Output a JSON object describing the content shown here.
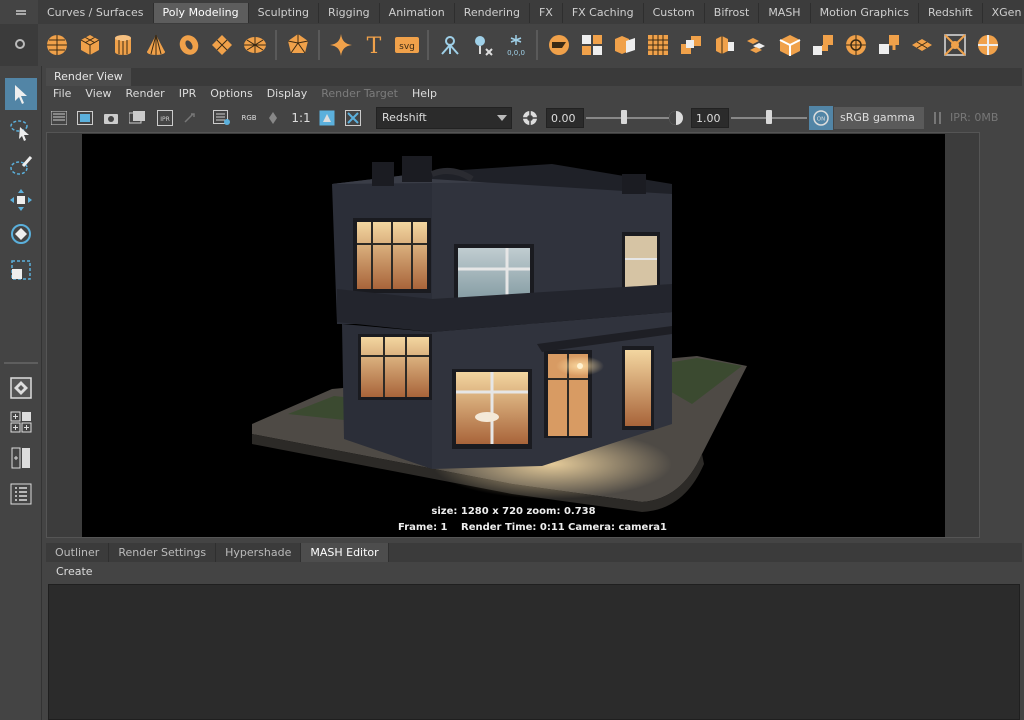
{
  "shelf": {
    "tabs": [
      "Curves / Surfaces",
      "Poly Modeling",
      "Sculpting",
      "Rigging",
      "Animation",
      "Rendering",
      "FX",
      "FX Caching",
      "Custom",
      "Bifrost",
      "MASH",
      "Motion Graphics",
      "Redshift",
      "XGen"
    ],
    "active_tab": "Poly Modeling",
    "icons": [
      "poly-sphere",
      "poly-cube",
      "poly-cylinder",
      "poly-cone",
      "poly-torus",
      "poly-plane",
      "poly-disc",
      "platonic-solid",
      "super-shape",
      "text",
      "svg",
      "mirror",
      "combine",
      "separate",
      "smooth",
      "bridge",
      "append",
      "extrude",
      "bevel",
      "merge",
      "multi-cut",
      "target-weld",
      "connect",
      "quad-draw",
      "crease",
      "wedge",
      "poke",
      "circularize",
      "sculpt"
    ],
    "svg_label": "svg",
    "text_label": "T",
    "accent_color": "#f0a14a"
  },
  "render_view": {
    "panel_title": "Render View",
    "menu": [
      "File",
      "View",
      "Render",
      "IPR",
      "Options",
      "Display",
      "Render Target",
      "Help"
    ],
    "ratio_label": "1:1",
    "rgb_label": "RGB",
    "renderer": "Redshift",
    "exposure": "0.00",
    "gamma": "1.00",
    "color_space": "sRGB gamma",
    "on_label": "ON",
    "ipr_status": "IPR: 0MB",
    "info_size": "size: 1280 x 720 zoom: 0.738",
    "info_frame": "Frame: 1",
    "info_render_time": "Render Time: 0:11",
    "info_camera": "Camera: camera1"
  },
  "bottom": {
    "tabs": [
      "Outliner",
      "Render Settings",
      "Hypershade",
      "MASH Editor"
    ],
    "active_tab": "MASH Editor",
    "menu_create": "Create"
  },
  "colors": {
    "selection_blue": "#5285a6",
    "panel_bg": "#444444"
  }
}
